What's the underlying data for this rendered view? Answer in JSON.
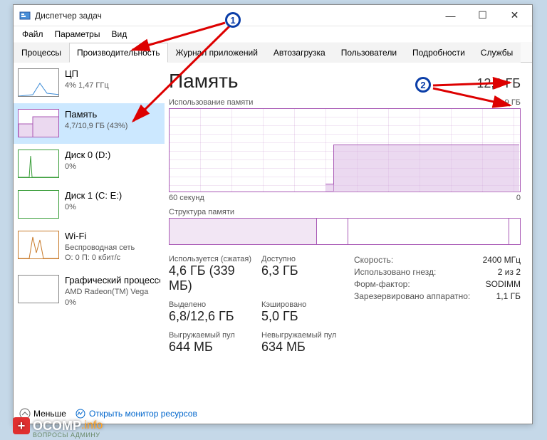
{
  "window": {
    "title": "Диспетчер задач",
    "controls": {
      "min": "—",
      "max": "☐",
      "close": "✕"
    }
  },
  "menu": [
    "Файл",
    "Параметры",
    "Вид"
  ],
  "tabs": [
    "Процессы",
    "Производительность",
    "Журнал приложений",
    "Автозагрузка",
    "Пользователи",
    "Подробности",
    "Службы"
  ],
  "sidebar": [
    {
      "title": "ЦП",
      "sub1": "4%  1,47 ГГц",
      "sub2": ""
    },
    {
      "title": "Память",
      "sub1": "4,7/10,9 ГБ (43%)",
      "sub2": ""
    },
    {
      "title": "Диск 0 (D:)",
      "sub1": "0%",
      "sub2": ""
    },
    {
      "title": "Диск 1 (C: E:)",
      "sub1": "0%",
      "sub2": ""
    },
    {
      "title": "Wi-Fi",
      "sub1": "Беспроводная сеть",
      "sub2": "О: 0 П: 0 кбит/с"
    },
    {
      "title": "Графический процессор",
      "sub1": "AMD Radeon(TM) Vega ",
      "sub2": "0%"
    }
  ],
  "main": {
    "title": "Память",
    "total": "12,0 ГБ",
    "usage_label": "Использование памяти",
    "usage_max": "10,9 ГБ",
    "graph_left": "60 секунд",
    "graph_right": "0",
    "comp_label": "Структура памяти"
  },
  "stats": {
    "in_use_label": "Используется (сжатая)",
    "in_use": "4,6 ГБ (339 МБ)",
    "avail_label": "Доступно",
    "avail": "6,3 ГБ",
    "commit_label": "Выделено",
    "commit": "6,8/12,6 ГБ",
    "cached_label": "Кэшировано",
    "cached": "5,0 ГБ",
    "paged_label": "Выгружаемый пул",
    "paged": "644 МБ",
    "nonpaged_label": "Невыгружаемый пул",
    "nonpaged": "634 МБ"
  },
  "info": {
    "speed_l": "Скорость:",
    "speed_v": "2400 МГц",
    "slots_l": "Использовано гнезд:",
    "slots_v": "2 из 2",
    "form_l": "Форм-фактор:",
    "form_v": "SODIMM",
    "hw_l": "Зарезервировано аппаратно:",
    "hw_v": "1,1 ГБ"
  },
  "footer": {
    "less": "Меньше",
    "open_rm": "Открыть монитор ресурсов"
  },
  "annotations": {
    "badge1": "1",
    "badge2": "2"
  },
  "watermark": {
    "brand": "OCOMP",
    "suffix": ".info",
    "sub": "ВОПРОСЫ АДМИНУ"
  },
  "chart_data": {
    "type": "area",
    "title": "Использование памяти",
    "xlabel": "60 секунд",
    "ylim": [
      0,
      10.9
    ],
    "values_gb_approx": [
      0.5,
      0.5,
      0.5,
      0.5,
      0.5,
      0.5,
      0.5,
      5.8,
      5.8,
      5.8,
      5.8,
      5.8,
      5.8,
      5.8,
      5.8,
      5.8
    ],
    "composition_gb_approx": [
      4.6,
      1.0,
      5.0,
      0.3
    ]
  }
}
